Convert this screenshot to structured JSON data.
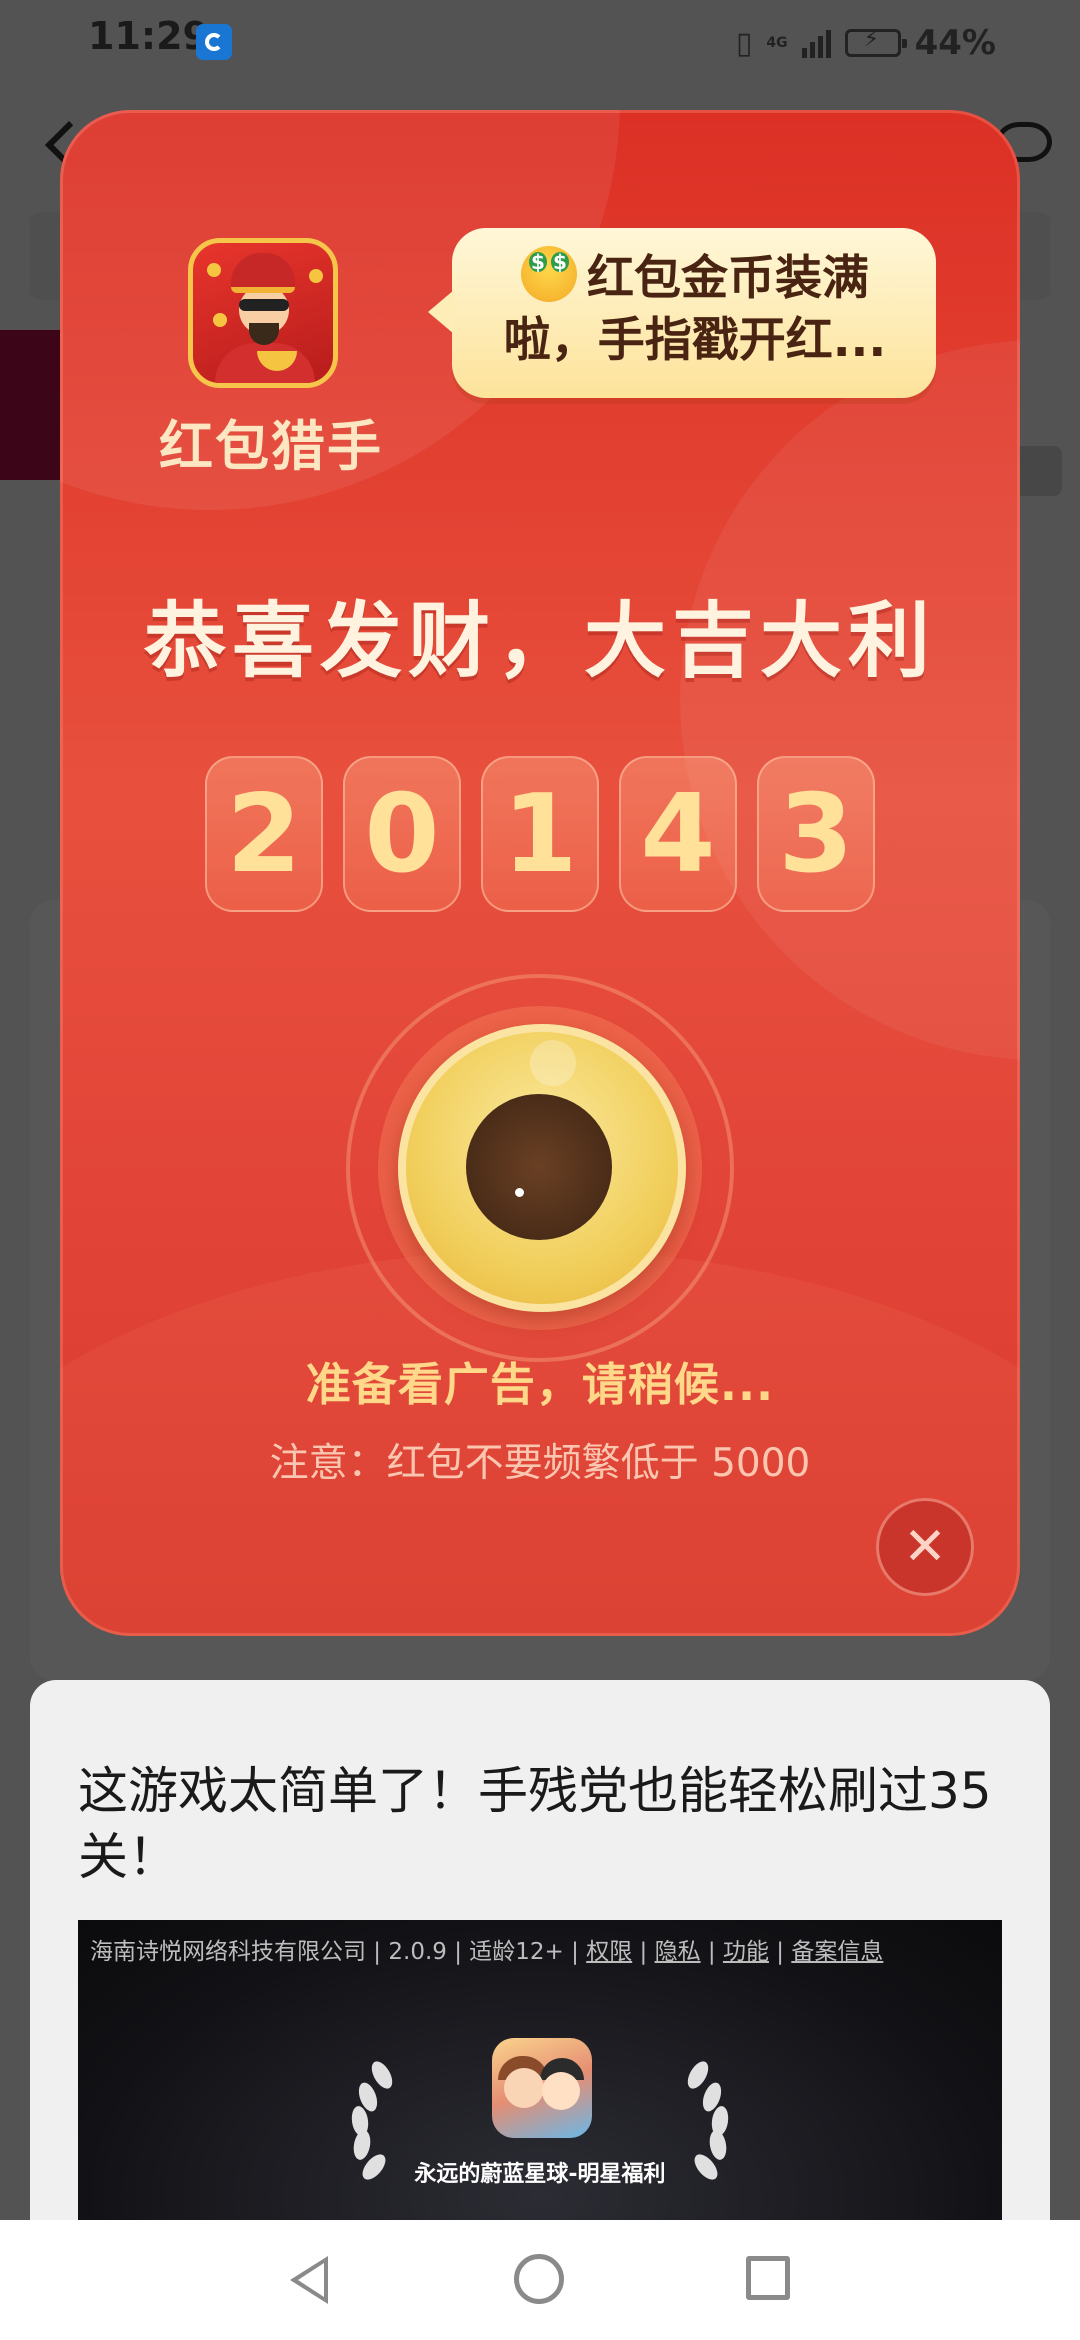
{
  "status_bar": {
    "time": "11:29",
    "network": "4G",
    "battery_percent": "44%",
    "icons": [
      "app-notification-icon",
      "vibrate-icon",
      "signal-icon",
      "battery-charging-icon"
    ]
  },
  "dialog": {
    "app_name": "红包猎手",
    "bubble_text": "红包金币装满啦，手指戳开红...",
    "headline": "恭喜发财，大吉大利",
    "digits": [
      "2",
      "0",
      "1",
      "4",
      "3"
    ],
    "loading_text": "准备看广告，请稍候...",
    "notice_text": "注意：红包不要频繁低于 5000",
    "close_icon": "✕",
    "colors": {
      "dialog_red": "#e24538",
      "digit_gold": "#ffe19a",
      "coin_gold": "#f1cf5c",
      "bubble_bg": "#fde39b"
    }
  },
  "ad": {
    "title": "这游戏太简单了！手残党也能轻松刷过35关！",
    "info_company": "海南诗悦网络科技有限公司 | 2.0.9 | 适龄12+ | ",
    "info_links": [
      "权限",
      "隐私",
      "功能",
      "备案信息"
    ],
    "game_name": "永远的蔚蓝星球-明星福利"
  },
  "nav_bar": {
    "buttons": [
      "back-icon",
      "home-icon",
      "recent-apps-icon"
    ]
  }
}
